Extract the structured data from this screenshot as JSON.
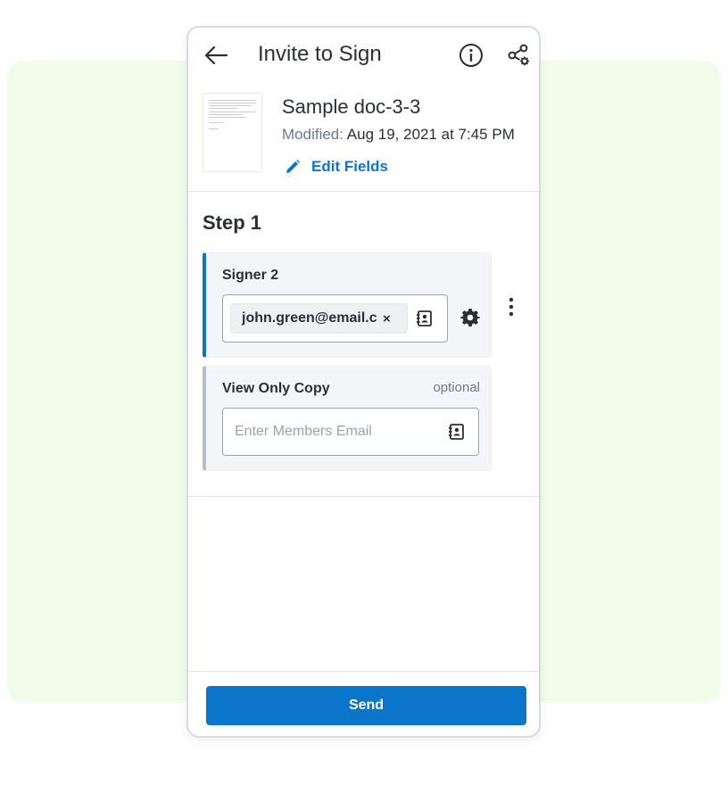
{
  "header": {
    "title": "Invite to Sign",
    "back_icon": "arrow-left-icon",
    "info_icon": "info-circle-icon",
    "share_icon": "share-settings-icon"
  },
  "document": {
    "name": "Sample doc-3-3",
    "modified_label": "Modified:",
    "modified_value": "Aug 19, 2021 at 7:45 PM",
    "edit_fields_label": "Edit Fields"
  },
  "step": {
    "title": "Step 1"
  },
  "signer": {
    "label": "Signer 2",
    "email_chip": "john.green@email.com",
    "remove_glyph": "×"
  },
  "viewer": {
    "label": "View Only Copy",
    "optional_label": "optional",
    "placeholder": "Enter Members Email"
  },
  "footer": {
    "send_label": "Send"
  },
  "colors": {
    "accent": "#0b75cc",
    "background_panel": "#effdea",
    "text": "#2b2f33",
    "muted": "#6d7a87"
  }
}
